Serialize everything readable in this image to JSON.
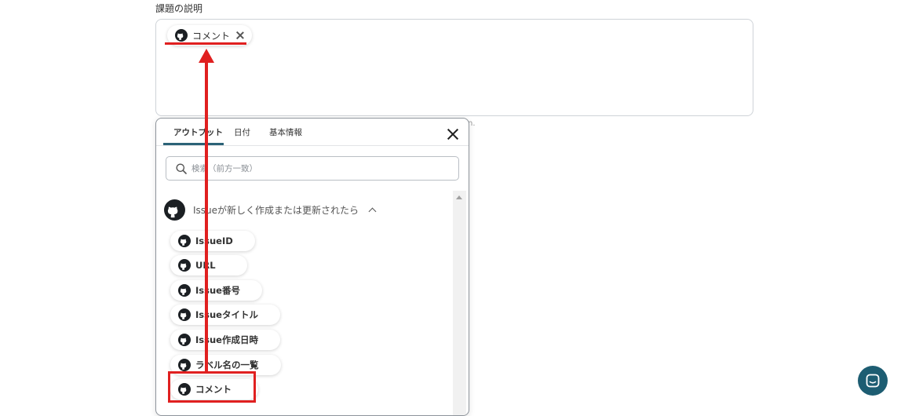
{
  "field": {
    "label": "課題の説明",
    "chip_label": "コメント",
    "helper_fragment": "n."
  },
  "popup": {
    "tabs": [
      {
        "label": "アウトプット"
      },
      {
        "label": "日付"
      },
      {
        "label": "基本情報"
      }
    ],
    "search_placeholder": "検索（前方一致）",
    "section_title": "Issueが新しく作成または更新されたら",
    "items": [
      {
        "label": "IssueID"
      },
      {
        "label": "URL"
      },
      {
        "label": "Issue番号"
      },
      {
        "label": "Issueタイトル"
      },
      {
        "label": "Issue作成日時"
      },
      {
        "label": "ラベル名の一覧"
      },
      {
        "label": "コメント"
      }
    ]
  },
  "colors": {
    "accent": "#2c6377",
    "annotation_red": "#e02020",
    "chat_button": "#1d5d72"
  },
  "icons": {
    "chip_icon": "github-icon",
    "close": "close-icon",
    "search": "search-icon",
    "chevron": "chevron-up-icon",
    "chat": "chat-icon"
  }
}
